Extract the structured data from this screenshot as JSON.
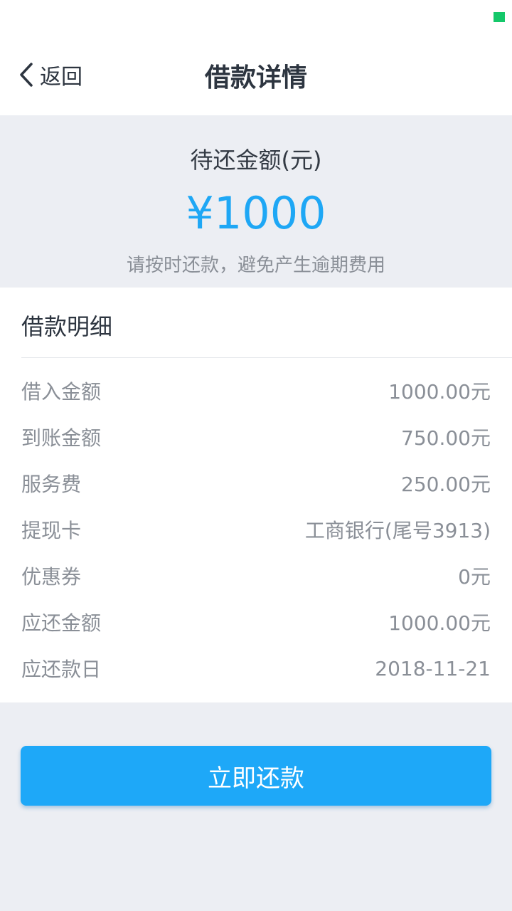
{
  "header": {
    "back_label": "返回",
    "title": "借款详情"
  },
  "summary": {
    "label": "待还金额(元)",
    "amount": "¥1000",
    "note": "请按时还款，避免产生逾期费用"
  },
  "details": {
    "title": "借款明细",
    "rows": [
      {
        "label": "借入金额",
        "value": "1000.00元"
      },
      {
        "label": "到账金额",
        "value": "750.00元"
      },
      {
        "label": "服务费",
        "value": "250.00元"
      },
      {
        "label": "提现卡",
        "value": "工商银行(尾号3913)"
      },
      {
        "label": "优惠券",
        "value": "0元"
      },
      {
        "label": "应还金额",
        "value": "1000.00元"
      },
      {
        "label": "应还款日",
        "value": "2018-11-21"
      }
    ]
  },
  "action": {
    "repay_label": "立即还款"
  },
  "colors": {
    "accent": "#1ea8f8",
    "status_indicator": "#15c86a",
    "amount": "#1ea7f5"
  },
  "icons": {
    "back": "chevron-left-icon",
    "status": "status-indicator-icon"
  }
}
